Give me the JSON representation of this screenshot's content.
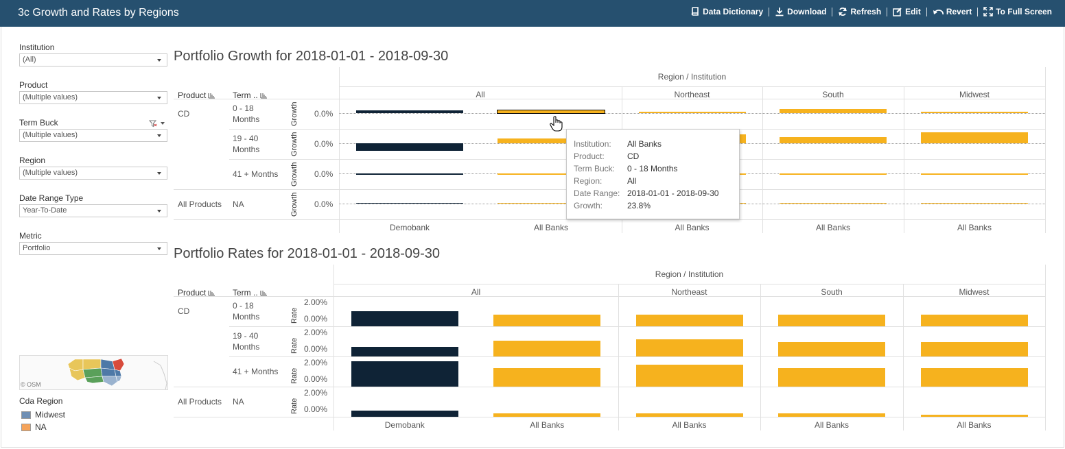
{
  "header": {
    "title": "3c Growth and Rates by Regions",
    "toolbar": [
      {
        "label": "Data Dictionary",
        "icon": "book-icon"
      },
      {
        "label": "Download",
        "icon": "download-icon"
      },
      {
        "label": "Refresh",
        "icon": "refresh-icon"
      },
      {
        "label": "Edit",
        "icon": "edit-icon"
      },
      {
        "label": "Revert",
        "icon": "revert-icon"
      },
      {
        "label": "To Full Screen",
        "icon": "fullscreen-icon"
      }
    ]
  },
  "filters": [
    {
      "label": "Institution",
      "value": "(All)"
    },
    {
      "label": "Product",
      "value": "(Multiple values)"
    },
    {
      "label": "Term Buck",
      "value": "(Multiple values)"
    },
    {
      "label": "Region",
      "value": "(Multiple values)"
    },
    {
      "label": "Date Range Type",
      "value": "Year-To-Date"
    },
    {
      "label": "Metric",
      "value": "Portfolio"
    }
  ],
  "map": {
    "attribution": "© OSM"
  },
  "legend": {
    "title": "Cda Region",
    "items": [
      {
        "label": "Midwest",
        "color": "#4e79a7"
      },
      {
        "label": "NA",
        "color": "#f28e2b"
      }
    ]
  },
  "growth": {
    "title": "Portfolio Growth for 2018-01-01 - 2018-09-30",
    "super_header": "Region / Institution",
    "product_header": "Product",
    "term_header": "Term ..",
    "axis_label": "Growth",
    "regions": [
      "All",
      "Northeast",
      "South",
      "Midwest"
    ],
    "institutions": [
      "Demobank",
      "All Banks",
      "All Banks",
      "All Banks",
      "All Banks"
    ],
    "rows": [
      {
        "product": "CD",
        "term": "0 - 18 Months",
        "tick": "0.0%"
      },
      {
        "product": "",
        "term": "19 - 40 Months",
        "tick": "0.0%"
      },
      {
        "product": "",
        "term": "41 + Months",
        "tick": "0.0%"
      },
      {
        "product": "All Products",
        "term": "NA",
        "tick": "0.0%"
      }
    ]
  },
  "rates": {
    "title": "Portfolio Rates for 2018-01-01 - 2018-09-30",
    "super_header": "Region / Institution",
    "product_header": "Product",
    "term_header": "Term ..",
    "axis_label": "Rate",
    "regions": [
      "All",
      "Northeast",
      "South",
      "Midwest"
    ],
    "institutions": [
      "Demobank",
      "All Banks",
      "All Banks",
      "All Banks",
      "All Banks"
    ],
    "rows": [
      {
        "product": "CD",
        "term": "0 - 18 Months",
        "tick_top": "2.00%",
        "tick_bottom": "0.00%"
      },
      {
        "product": "",
        "term": "19 - 40 Months",
        "tick_top": "2.00%",
        "tick_bottom": "0.00%"
      },
      {
        "product": "",
        "term": "41 + Months",
        "tick_top": "2.00%",
        "tick_bottom": "0.00%"
      },
      {
        "product": "All Products",
        "term": "NA",
        "tick_top": "2.00%",
        "tick_bottom": "0.00%"
      }
    ]
  },
  "chart_data": [
    {
      "type": "bar",
      "title": "Portfolio Growth for 2018-01-01 - 2018-09-30",
      "categories": [
        "All / Demobank",
        "All / All Banks",
        "Northeast / All Banks",
        "South / All Banks",
        "Midwest / All Banks"
      ],
      "series": [
        {
          "name": "0 - 18 Months",
          "values": [
            0.05,
            0.05,
            0.02,
            0.07,
            0.02
          ]
        },
        {
          "name": "19 - 40 Months",
          "values": [
            -0.12,
            0.08,
            0.14,
            0.1,
            0.18
          ]
        },
        {
          "name": "41 + Months",
          "values": [
            -0.02,
            -0.01,
            -0.01,
            -0.01,
            -0.01
          ]
        },
        {
          "name": "NA",
          "values": [
            0.005,
            0.003,
            0.003,
            0.003,
            0.003
          ]
        }
      ],
      "highlight": {
        "institution": "All Banks",
        "product": "CD",
        "term": "0 - 18 Months",
        "region": "All",
        "growth": "23.8%"
      }
    },
    {
      "type": "bar",
      "title": "Portfolio Rates for 2018-01-01 - 2018-09-30",
      "categories": [
        "All / Demobank",
        "All / All Banks",
        "Northeast / All Banks",
        "South / All Banks",
        "Midwest / All Banks"
      ],
      "ylim": [
        0,
        2.0
      ],
      "series": [
        {
          "name": "0 - 18 Months",
          "values": [
            1.3,
            1.0,
            1.0,
            1.0,
            1.0
          ]
        },
        {
          "name": "19 - 40 Months",
          "values": [
            0.8,
            1.35,
            1.45,
            1.25,
            1.25
          ]
        },
        {
          "name": "41 + Months",
          "values": [
            2.2,
            1.6,
            1.9,
            1.6,
            1.6
          ]
        },
        {
          "name": "NA",
          "values": [
            0.55,
            0.3,
            0.3,
            0.3,
            0.2
          ]
        }
      ]
    }
  ],
  "tooltip": [
    {
      "key": "Institution:",
      "value": "All Banks"
    },
    {
      "key": "Product:",
      "value": "CD"
    },
    {
      "key": "Term Buck:",
      "value": "0 - 18 Months"
    },
    {
      "key": "Region:",
      "value": "All"
    },
    {
      "key": "Date Range:",
      "value": "2018-01-01 - 2018-09-30"
    },
    {
      "key": "Growth:",
      "value": "23.8%"
    }
  ],
  "colors": {
    "header": "#26506f",
    "demobank": "#0f2336",
    "allbanks": "#f6b21e"
  }
}
